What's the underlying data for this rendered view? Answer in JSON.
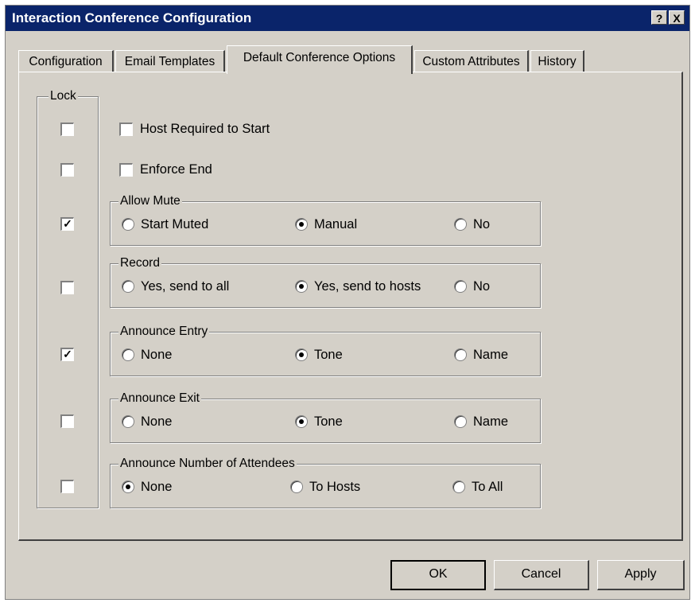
{
  "window": {
    "title": "Interaction Conference Configuration",
    "help_icon": "?",
    "close_icon": "X"
  },
  "tabs": [
    {
      "label": "Configuration",
      "active": false
    },
    {
      "label": "Email Templates",
      "active": false
    },
    {
      "label": "Default Conference Options",
      "active": true
    },
    {
      "label": "Custom Attributes",
      "active": false
    },
    {
      "label": "History",
      "active": false
    }
  ],
  "lock": {
    "label": "Lock",
    "checks": [
      false,
      false,
      true,
      false,
      true,
      false,
      false
    ]
  },
  "options": {
    "host_required": {
      "label": "Host Required to Start",
      "checked": false
    },
    "enforce_end": {
      "label": "Enforce End",
      "checked": false
    }
  },
  "groups": [
    {
      "label": "Allow Mute",
      "options": [
        "Start Muted",
        "Manual",
        "No"
      ],
      "selected": 1
    },
    {
      "label": "Record",
      "options": [
        "Yes, send to all",
        "Yes, send to hosts",
        "No"
      ],
      "selected": 1
    },
    {
      "label": "Announce Entry",
      "options": [
        "None",
        "Tone",
        "Name"
      ],
      "selected": 1
    },
    {
      "label": "Announce Exit",
      "options": [
        "None",
        "Tone",
        "Name"
      ],
      "selected": 1
    },
    {
      "label": "Announce Number of Attendees",
      "options": [
        "None",
        "To Hosts",
        "To All"
      ],
      "selected": 0
    }
  ],
  "buttons": {
    "ok": "OK",
    "cancel": "Cancel",
    "apply": "Apply"
  }
}
